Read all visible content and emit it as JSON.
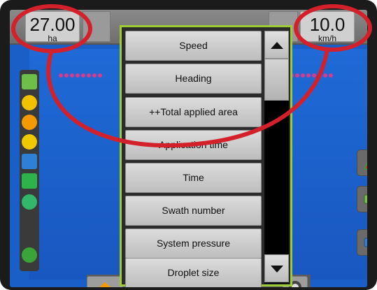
{
  "readouts": {
    "area": {
      "value": "27.00",
      "unit": "ha"
    },
    "speed": {
      "value": "10.0",
      "unit": "km/h"
    }
  },
  "list": {
    "items": [
      "Speed",
      "Heading",
      "++Total applied area",
      "Application time",
      "Time",
      "Swath number",
      "System pressure",
      "Droplet size"
    ],
    "selected_index": 3
  },
  "icons": {
    "left_tools": [
      "boom-icon",
      "swath-icon",
      "sun-icon",
      "flag-icon",
      "camera-icon",
      "nozzle-icon",
      "droplet-icon",
      "settings-icon"
    ],
    "right_buttons": [
      "navigation-arrow-icon",
      "chat-bubble-green-icon",
      "chat-bubble-blue-icon"
    ],
    "bottom": [
      "home-icon",
      "tractor-icon",
      "gauge-icon"
    ]
  },
  "colors": {
    "highlight": "#d4202a",
    "panel_border": "#9ccb36",
    "field": "#1a5ec8"
  }
}
